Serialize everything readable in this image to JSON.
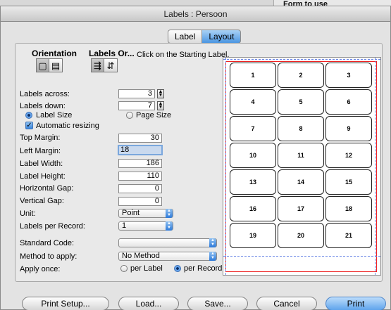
{
  "background": {
    "card_title": "Form to use"
  },
  "window": {
    "title": "Labels : Persoon"
  },
  "tabs": [
    {
      "label": "Label",
      "active": false
    },
    {
      "label": "Layout",
      "active": true
    }
  ],
  "headers": {
    "orientation": "Orientation",
    "labels_order": "Labels Or...",
    "hint": "Click on the Starting Label."
  },
  "icons": {
    "orientation": [
      "portrait-icon",
      "landscape-icon"
    ],
    "order": [
      "order-across-icon",
      "order-down-icon"
    ]
  },
  "fields": {
    "labels_across": {
      "label": "Labels across:",
      "value": "3"
    },
    "labels_down": {
      "label": "Labels down:",
      "value": "7"
    },
    "label_size": "Label Size",
    "page_size": "Page Size",
    "auto_resize": "Automatic resizing",
    "top_margin": {
      "label": "Top Margin:",
      "value": "30"
    },
    "left_margin": {
      "label": "Left Margin:",
      "value": "18"
    },
    "label_width": {
      "label": "Label Width:",
      "value": "186"
    },
    "label_height": {
      "label": "Label Height:",
      "value": "110"
    },
    "horizontal_gap": {
      "label": "Horizontal Gap:",
      "value": "0"
    },
    "vertical_gap": {
      "label": "Vertical Gap:",
      "value": "0"
    },
    "unit": {
      "label": "Unit:",
      "value": "Point"
    },
    "labels_per_record": {
      "label": "Labels per Record:",
      "value": "1"
    },
    "standard_code": {
      "label": "Standard Code:",
      "value": ""
    },
    "method": {
      "label": "Method to apply:",
      "value": "No Method"
    },
    "apply_once": {
      "label": "Apply once:",
      "per_label": "per Label",
      "per_record": "per Record"
    }
  },
  "preview": {
    "cells": [
      "1",
      "2",
      "3",
      "4",
      "5",
      "6",
      "7",
      "8",
      "9",
      "10",
      "11",
      "12",
      "13",
      "14",
      "15",
      "16",
      "17",
      "18",
      "19",
      "20",
      "21"
    ]
  },
  "buttons": {
    "print_setup": "Print Setup...",
    "load": "Load...",
    "save": "Save...",
    "cancel": "Cancel",
    "print": "Print"
  }
}
